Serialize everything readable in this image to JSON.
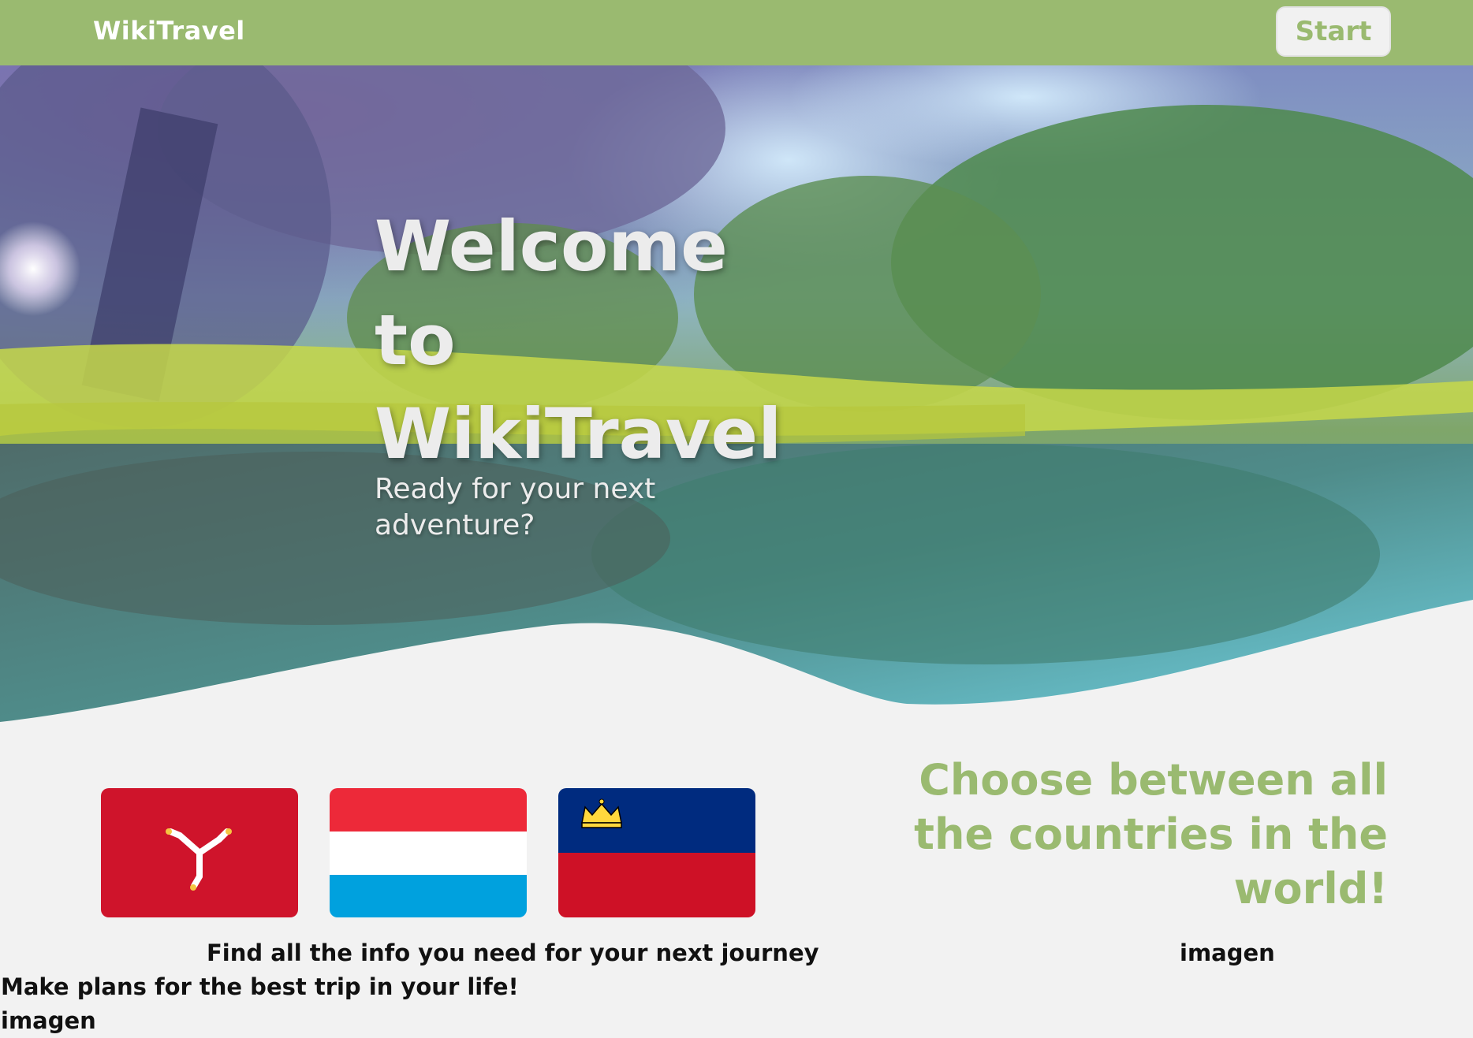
{
  "navbar": {
    "brand": "WikiTravel",
    "start_label": "Start"
  },
  "hero": {
    "title_lines": [
      "Welcome",
      "to",
      "WikiTravel"
    ],
    "subtitle": "Ready for your next adventure?"
  },
  "flags": [
    {
      "icon": "isle-of-man-flag-icon"
    },
    {
      "icon": "luxembourg-flag-icon"
    },
    {
      "icon": "liechtenstein-flag-icon"
    }
  ],
  "choose": {
    "heading": "Choose between all the countries in the world!"
  },
  "texts": {
    "info": "Find all the info you need for your next journey",
    "plans": "Make plans for the best trip in your life!",
    "image_placeholder_right": "imagen",
    "image_placeholder_left": "imagen"
  },
  "colors": {
    "accent": "#9aba70",
    "background": "#f2f2f2",
    "button_bg": "#f1f1f1"
  }
}
